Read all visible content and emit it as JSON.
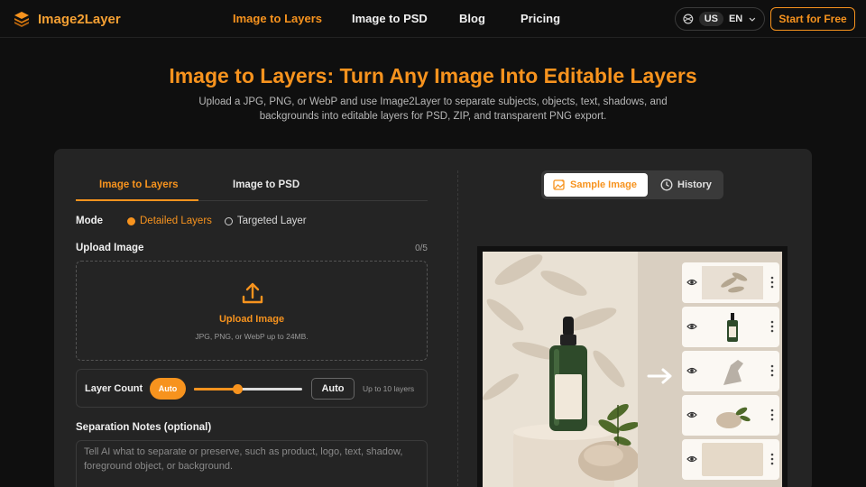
{
  "header": {
    "brand": "Image2Layer",
    "nav": [
      "Image to Layers",
      "Image to PSD",
      "Blog",
      "Pricing"
    ],
    "lang_region": "US",
    "lang_code": "EN",
    "cta": "Start for Free"
  },
  "hero": {
    "title": "Image to Layers: Turn Any Image Into Editable Layers",
    "subtitle": "Upload a JPG, PNG, or WebP and use Image2Layer to separate subjects, objects, text, shadows, and backgrounds into editable layers for PSD, ZIP, and transparent PNG export."
  },
  "tool": {
    "tabs": [
      "Image to Layers",
      "Image to PSD"
    ],
    "mode_label": "Mode",
    "mode_options": [
      "Detailed Layers",
      "Targeted Layer"
    ],
    "upload_label": "Upload Image",
    "upload_count": "0/5",
    "upload_title": "Upload Image",
    "upload_hint": "JPG, PNG, or WebP up to 24MB.",
    "layer_count_label": "Layer Count",
    "layer_auto_pill": "Auto",
    "layer_auto_value": "Auto",
    "layer_slider_fraction": 0.4,
    "layer_hint": "Up to 10 layers",
    "notes_label": "Separation Notes (optional)",
    "notes_placeholder": "Tell AI what to separate or preserve, such as product, logo, text, shadow, foreground object, or background."
  },
  "preview": {
    "sample_label": "Sample Image",
    "history_label": "History"
  },
  "colors": {
    "accent": "#f7931e",
    "background": "#0f0f0f",
    "panel": "#242424"
  }
}
